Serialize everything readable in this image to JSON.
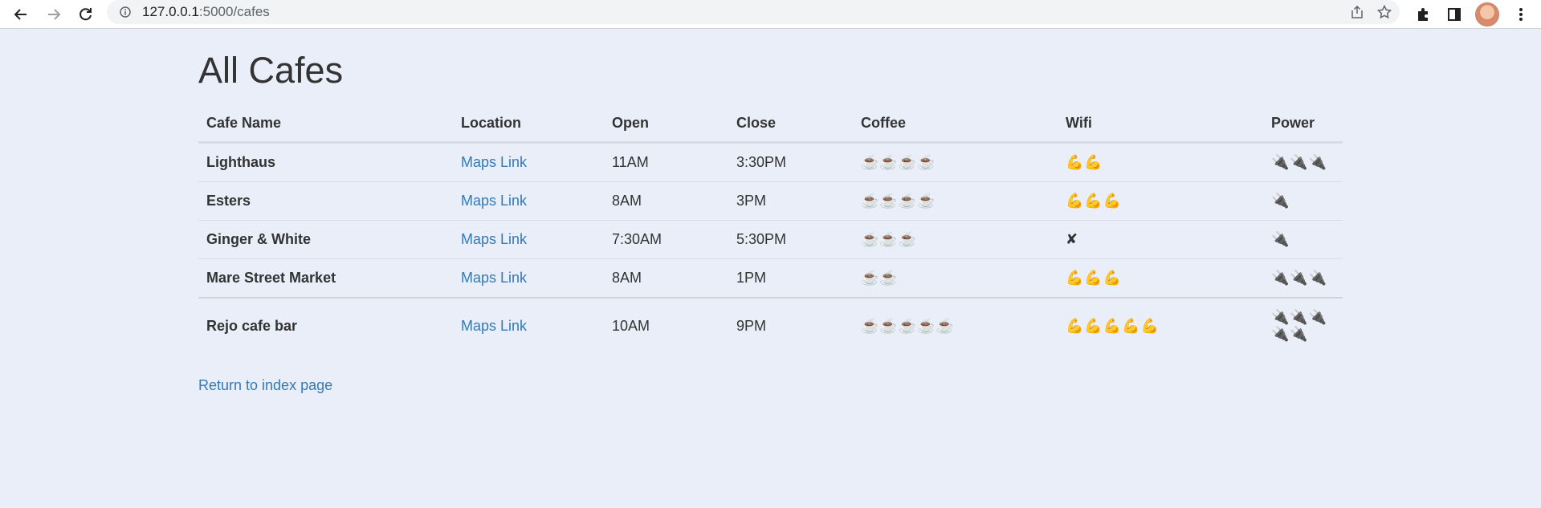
{
  "browser": {
    "url_host": "127.0.0.1",
    "url_path": ":5000/cafes"
  },
  "page": {
    "title": "All Cafes",
    "return_link": "Return to index page"
  },
  "table": {
    "headers": [
      "Cafe Name",
      "Location",
      "Open",
      "Close",
      "Coffee",
      "Wifi",
      "Power"
    ],
    "rows": [
      {
        "name": "Lighthaus",
        "location": "Maps Link",
        "open": "11AM",
        "close": "3:30PM",
        "coffee": "☕☕☕☕",
        "wifi": "💪💪",
        "power": "🔌🔌🔌"
      },
      {
        "name": "Esters",
        "location": "Maps Link",
        "open": "8AM",
        "close": "3PM",
        "coffee": "☕☕☕☕",
        "wifi": "💪💪💪",
        "power": "🔌"
      },
      {
        "name": "Ginger & White",
        "location": "Maps Link",
        "open": "7:30AM",
        "close": "5:30PM",
        "coffee": "☕☕☕",
        "wifi": "✘",
        "power": "🔌"
      },
      {
        "name": "Mare Street Market",
        "location": "Maps Link",
        "open": "8AM",
        "close": "1PM",
        "coffee": "☕☕",
        "wifi": "💪💪💪",
        "power": "🔌🔌🔌"
      },
      {
        "name": "Rejo cafe bar",
        "location": "Maps Link",
        "open": "10AM",
        "close": "9PM",
        "coffee": "☕☕☕☕☕",
        "wifi": "💪💪💪💪💪",
        "power": "🔌🔌🔌🔌🔌"
      }
    ]
  },
  "icons": {
    "back": "back-arrow-icon",
    "forward": "forward-arrow-icon",
    "reload": "reload-icon",
    "info": "info-icon",
    "share": "share-icon",
    "star": "star-icon",
    "extensions": "puzzle-icon",
    "sidepanel": "side-panel-icon",
    "menu": "kebab-menu-icon"
  },
  "colors": {
    "background": "#e9eef8",
    "link": "#337ab7",
    "text": "#333333"
  }
}
